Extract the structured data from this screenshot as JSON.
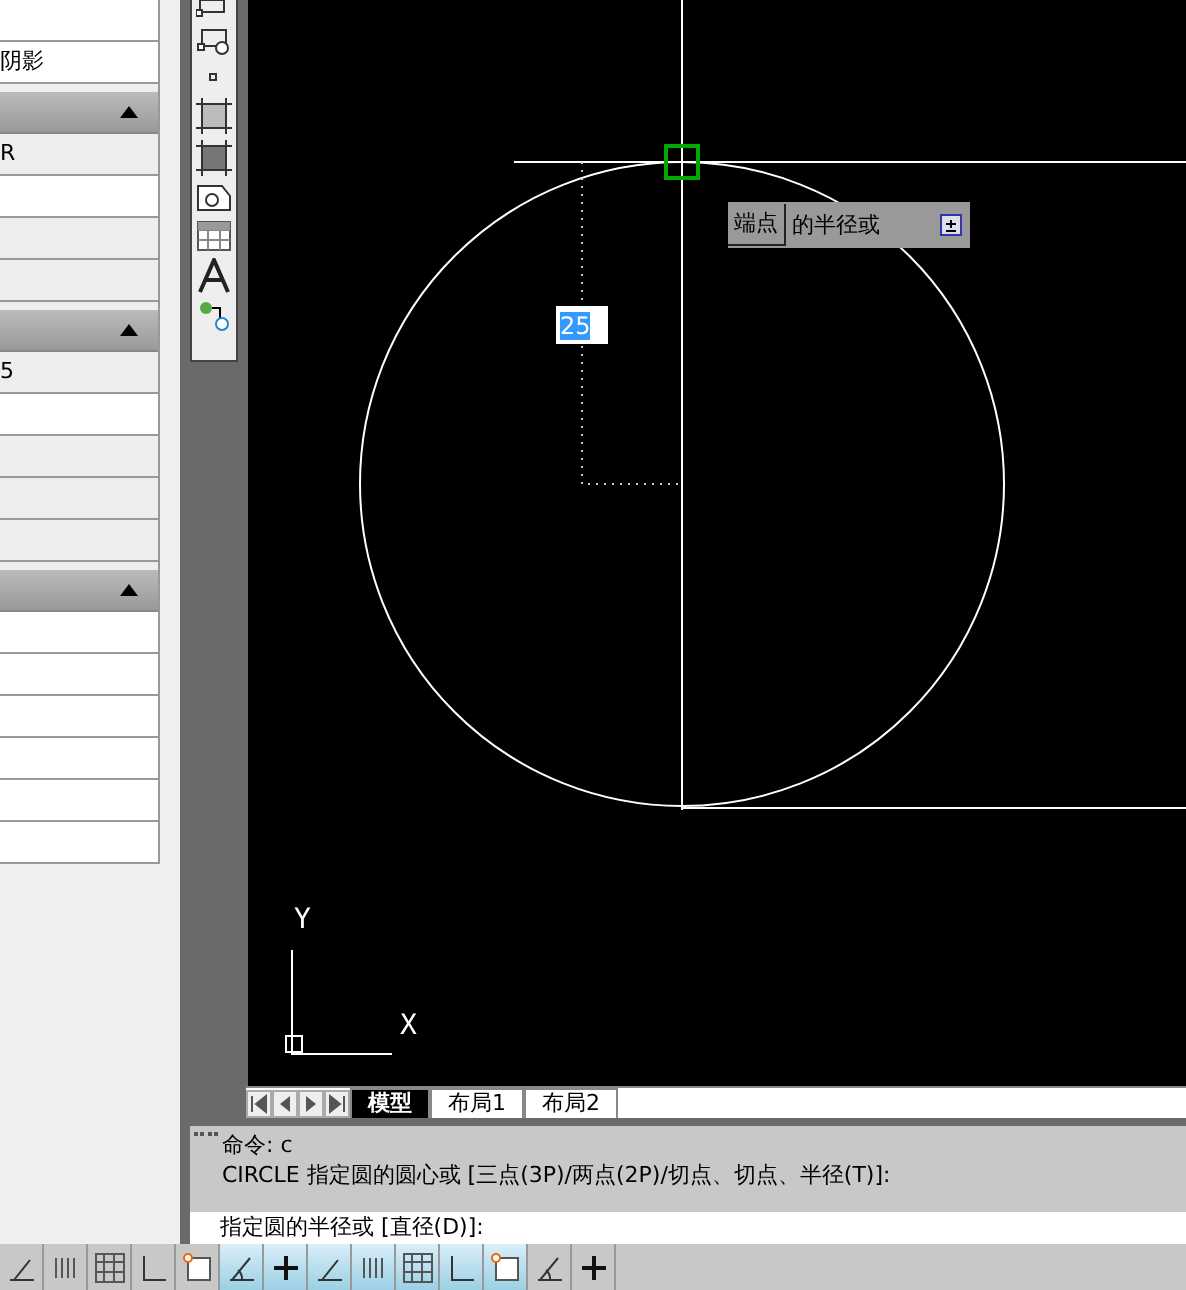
{
  "properties_panel": {
    "top_value": "阴影",
    "sections": [
      {
        "expanded": true,
        "first_value": "R"
      },
      {
        "expanded": true,
        "first_value": "5"
      },
      {
        "expanded": true
      }
    ]
  },
  "drawing": {
    "tooltip": {
      "key": "端点",
      "text": "的半径或"
    },
    "dynamic_input": {
      "value": "25",
      "selected": true
    },
    "ucs": {
      "y_label": "Y",
      "x_label": "X"
    }
  },
  "layout_tabs": [
    {
      "label": "模型",
      "selected": true
    },
    {
      "label": "布局1",
      "selected": false
    },
    {
      "label": "布局2",
      "selected": false
    }
  ],
  "command_history": [
    "命令: c",
    "CIRCLE 指定圆的圆心或 [三点(3P)/两点(2P)/切点、切点、半径(T)]:"
  ],
  "command_prompt": "指定圆的半径或 [直径(D)]:",
  "status_toggles": [
    {
      "on": false
    },
    {
      "on": false
    },
    {
      "on": false
    },
    {
      "on": false
    },
    {
      "on": false
    },
    {
      "on": true
    },
    {
      "on": true
    },
    {
      "on": true
    },
    {
      "on": true
    },
    {
      "on": true
    },
    {
      "on": true
    },
    {
      "on": true
    },
    {
      "on": false
    },
    {
      "on": false
    }
  ]
}
